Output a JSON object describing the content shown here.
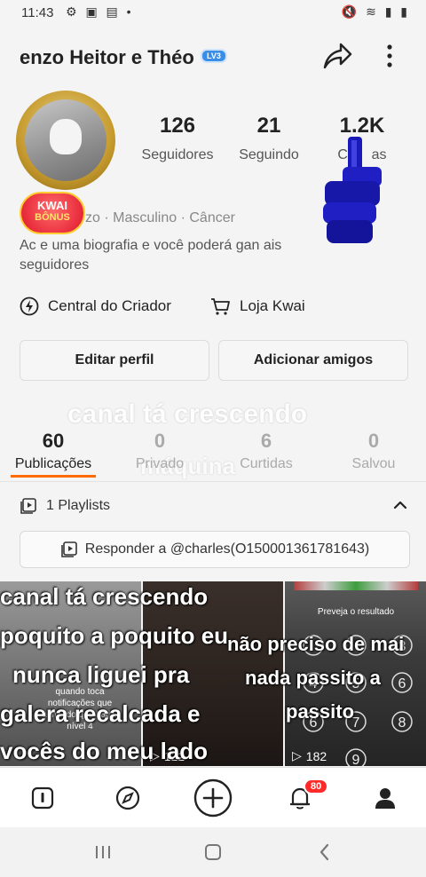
{
  "status_bar": {
    "time": "11:43",
    "left_icons": "⚙ ▣ ▤ •",
    "right_icons": "🔇 ≋ ▮ ▮"
  },
  "header": {
    "username": "enzo Heitor e Théo",
    "level_badge": "LV3",
    "share_icon": "share-arrow-icon",
    "more_icon": "more-vertical-icon"
  },
  "profile": {
    "kwai_badge_line1": "KWAI",
    "kwai_badge_line2": "BÔNUS",
    "meta": "zo · Masculino · Câncer",
    "bio_line1": "Ac e uma biografia e você poderá gan ais",
    "bio_line2": "seguidores"
  },
  "stats": [
    {
      "value": "126",
      "label": "Seguidores"
    },
    {
      "value": "21",
      "label": "Seguindo"
    },
    {
      "value": "1.2K",
      "label": "Cu    as"
    }
  ],
  "links": {
    "creator_center": "Central do Criador",
    "kwai_shop": "Loja Kwai"
  },
  "buttons": {
    "edit_profile": "Editar perfil",
    "add_friends": "Adicionar amigos"
  },
  "overlay": {
    "line1": "canal tá crescendo",
    "line2": "máquina"
  },
  "tabs": [
    {
      "count": "60",
      "label": "Publicações",
      "active": true
    },
    {
      "count": "0",
      "label": "Privado",
      "active": false
    },
    {
      "count": "6",
      "label": "Curtidas",
      "active": false
    },
    {
      "count": "0",
      "label": "Salvou",
      "active": false
    }
  ],
  "playlists": {
    "label": "1 Playlists",
    "reply_label": "Responder a @charles(O150001361781643)"
  },
  "grid": {
    "cell1_caption": "quando toca notificações que achando que bati o nível 4",
    "cell1_views": "",
    "cell2_views": "122",
    "cell3_header": "Preveja o resultado",
    "cell3_views": "182",
    "big_text_lines": [
      "canal tá crescendo",
      "poquito a poquito eu",
      "nunca liguei pra",
      "galera recalcada e",
      "vocês do meu lado"
    ],
    "big_text_right_lines": [
      "não preciso de mai",
      "nada passito a",
      "passito"
    ]
  },
  "bottom_nav": {
    "notification_count": "80"
  },
  "colors": {
    "accent": "#ff6b00",
    "level_badge": "#3a8ee6",
    "notification_badge": "#ff2a2a"
  }
}
